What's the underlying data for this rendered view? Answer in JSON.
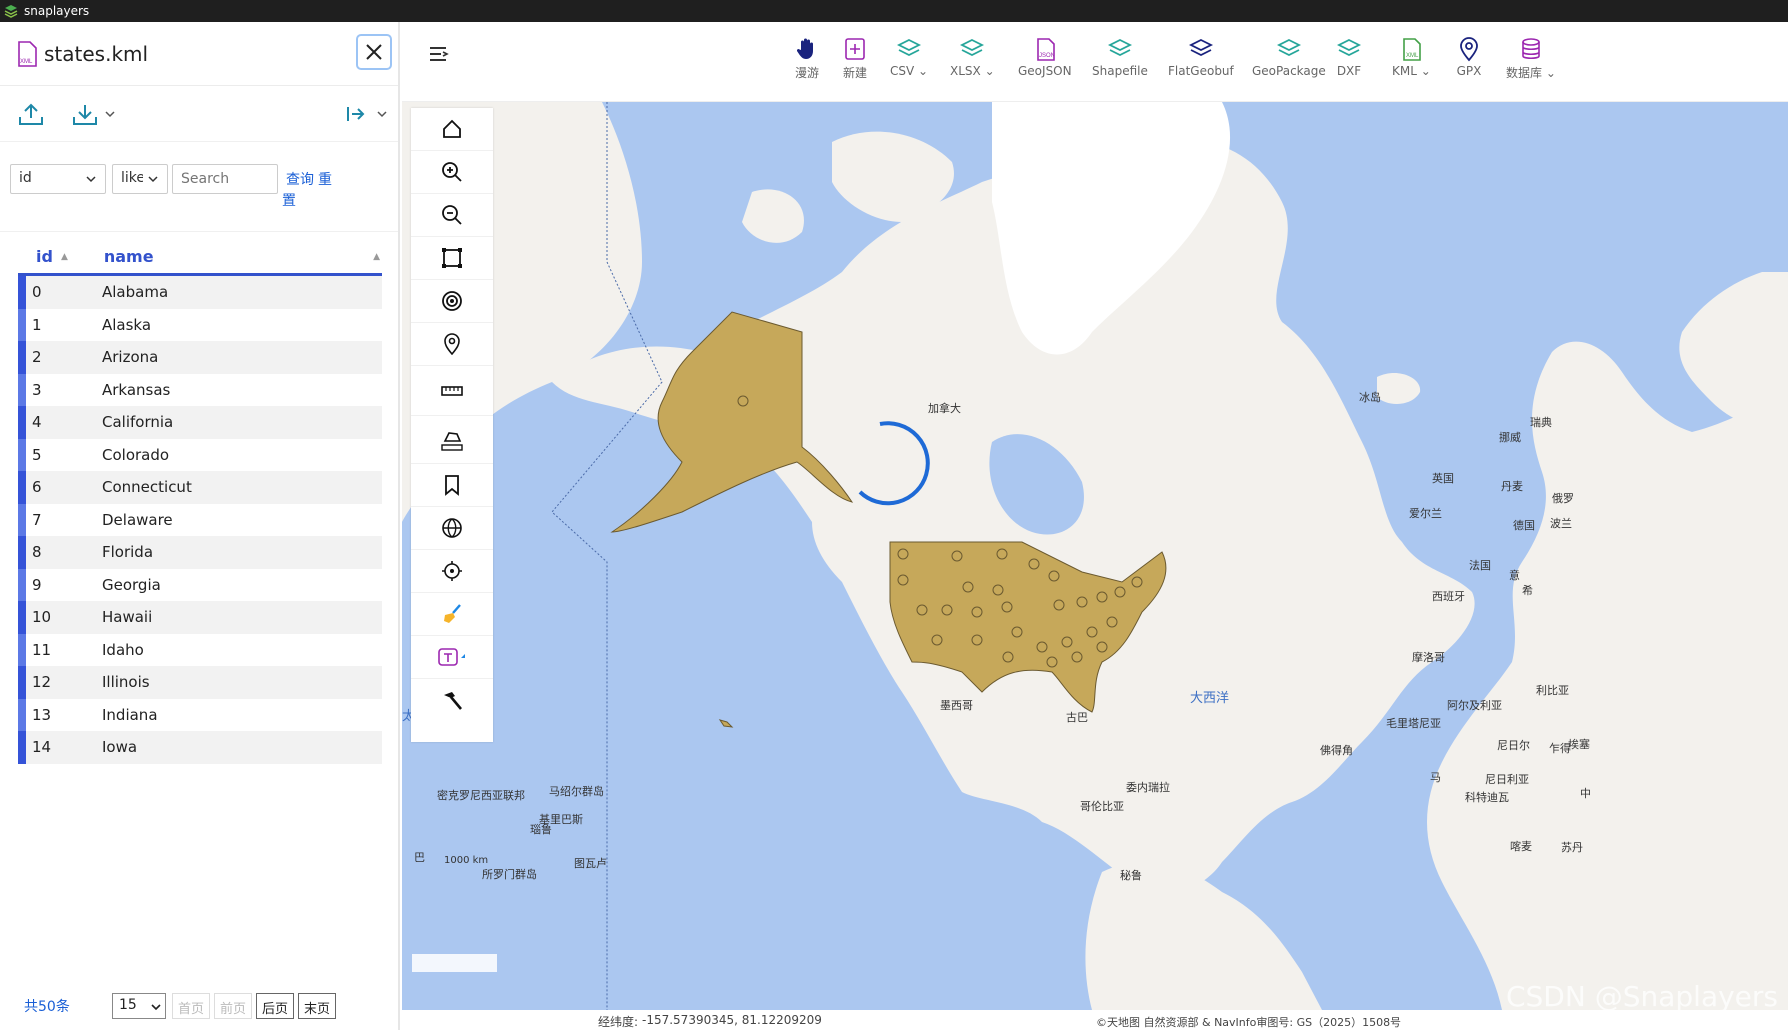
{
  "window": {
    "title": "snaplayers"
  },
  "panel": {
    "file_name": "states.kml",
    "query": {
      "field": "id",
      "operator": "like",
      "search_placeholder": "Search",
      "query_link": "查询",
      "reset_link_1": "重",
      "reset_link_2": "置"
    },
    "table": {
      "columns": [
        "id",
        "name"
      ],
      "rows": [
        {
          "id": "0",
          "name": "Alabama"
        },
        {
          "id": "1",
          "name": "Alaska"
        },
        {
          "id": "2",
          "name": "Arizona"
        },
        {
          "id": "3",
          "name": "Arkansas"
        },
        {
          "id": "4",
          "name": "California"
        },
        {
          "id": "5",
          "name": "Colorado"
        },
        {
          "id": "6",
          "name": "Connecticut"
        },
        {
          "id": "7",
          "name": "Delaware"
        },
        {
          "id": "8",
          "name": "Florida"
        },
        {
          "id": "9",
          "name": "Georgia"
        },
        {
          "id": "10",
          "name": "Hawaii"
        },
        {
          "id": "11",
          "name": "Idaho"
        },
        {
          "id": "12",
          "name": "Illinois"
        },
        {
          "id": "13",
          "name": "Indiana"
        },
        {
          "id": "14",
          "name": "Iowa"
        }
      ]
    },
    "pager": {
      "total": "共50条",
      "page_size": "15",
      "first": "首页",
      "prev": "前页",
      "next": "后页",
      "last": "末页"
    }
  },
  "toolbar": {
    "items": [
      {
        "label": "漫游",
        "icon": "hand-icon",
        "color": "#1a237e"
      },
      {
        "label": "新建",
        "icon": "new-icon",
        "color": "#9c27b0"
      },
      {
        "label": "CSV",
        "icon": "layers-icon",
        "color": "#26a69a",
        "dropdown": true
      },
      {
        "label": "XLSX",
        "icon": "layers-icon",
        "color": "#26a69a",
        "dropdown": true
      },
      {
        "label": "GeoJSON",
        "icon": "geojson-file-icon",
        "color": "#9c27b0"
      },
      {
        "label": "Shapefile",
        "icon": "layers-icon",
        "color": "#26a69a"
      },
      {
        "label": "FlatGeobuf",
        "icon": "layers-icon",
        "color": "#1a237e"
      },
      {
        "label": "GeoPackage",
        "icon": "layers-icon",
        "color": "#26a69a"
      },
      {
        "label": "DXF",
        "icon": "layers-icon",
        "color": "#26a69a"
      },
      {
        "label": "KML",
        "icon": "kml-file-icon",
        "color": "#43a047",
        "dropdown": true
      },
      {
        "label": "GPX",
        "icon": "pin-icon",
        "color": "#1a237e"
      },
      {
        "label": "数据库",
        "icon": "database-icon",
        "color": "#9c27b0",
        "dropdown": true
      }
    ]
  },
  "map": {
    "labels": {
      "canada": "加拿大",
      "iceland": "冰岛",
      "sweden": "瑞典",
      "norway": "挪威",
      "uk": "英国",
      "denmark": "丹麦",
      "russia": "俄罗",
      "ireland": "爱尔兰",
      "germany": "德国",
      "poland": "波兰",
      "france": "法国",
      "italy": "意",
      "spain": "西班牙",
      "greece": "希",
      "morocco": "摩洛哥",
      "algeria": "阿尔及利亚",
      "libya": "利比亚",
      "mauritania": "毛里塔尼亚",
      "niger": "尼日尔",
      "mali": "马",
      "nigeria": "尼日利亚",
      "chad": "乍得",
      "cape_verde": "佛得角",
      "atlantic": "大西洋",
      "pacific": "太平洋",
      "mexico": "墨西哥",
      "cuba": "古巴",
      "venezuela": "委内瑞拉",
      "colombia": "哥伦比亚",
      "micronesia": "密克罗尼西亚联邦",
      "marshall": "马绍尔群岛",
      "kiribati": "基里巴斯",
      "nauru": "瑙鲁",
      "tuvalu": "图瓦卢",
      "solomon": "所罗门群岛",
      "peru": "秘鲁",
      "ethiopia": "埃塞",
      "cameroon": "喀麦",
      "sudan": "苏丹",
      "central_africa": "中",
      "kurdish": "科特迪瓦",
      "ba": "巴",
      "scale": "1000 km"
    },
    "coords_label": "经纬度:",
    "coords_value": "-157.57390345, 81.12209209",
    "attribution": "©天地图 自然资源部 & NavInfo审图号: GS（2025）1508号",
    "watermark": "CSDN @Snaplayers",
    "region_fill": "#c6a85a"
  }
}
